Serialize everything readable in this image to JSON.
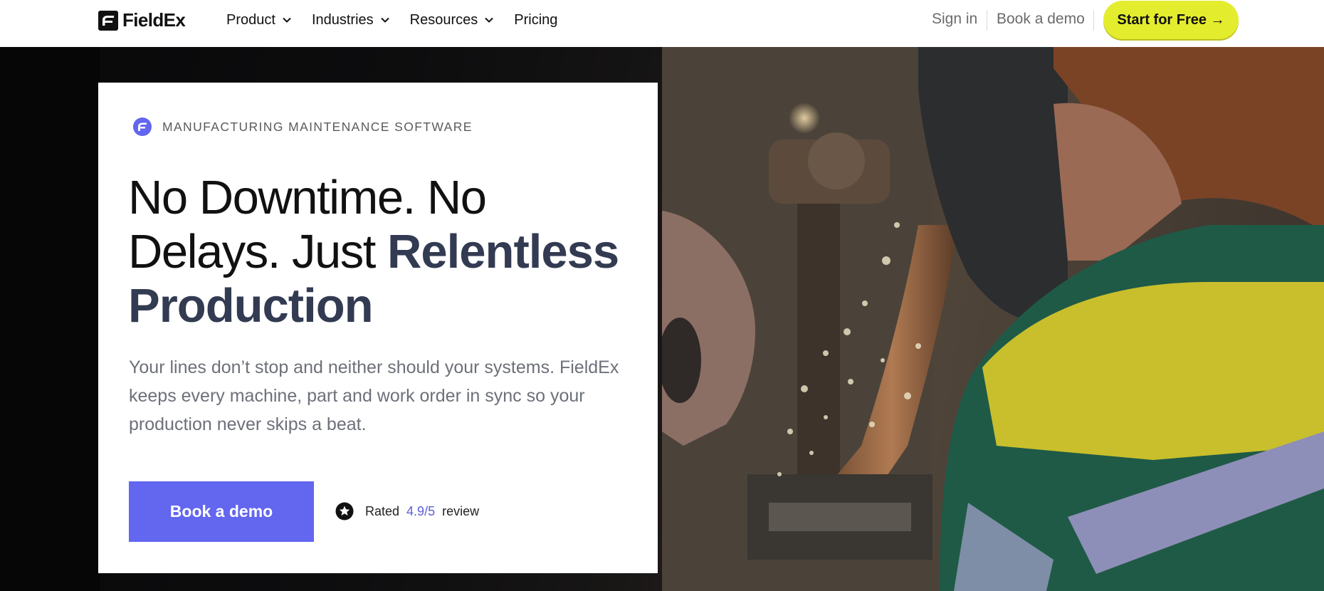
{
  "brand": {
    "name": "FieldEx",
    "logo_icon": "fieldex-logo-icon"
  },
  "nav": {
    "items": [
      {
        "label": "Product",
        "has_dropdown": true
      },
      {
        "label": "Industries",
        "has_dropdown": true
      },
      {
        "label": "Resources",
        "has_dropdown": true
      },
      {
        "label": "Pricing",
        "has_dropdown": false
      }
    ],
    "sign_in": "Sign in",
    "book_demo": "Book a demo",
    "cta": "Start for Free →"
  },
  "hero": {
    "eyebrow": "MANUFACTURING MAINTENANCE SOFTWARE",
    "headline_plain": "No Downtime. No Delays. Just ",
    "headline_accent": "Relentless Production",
    "subtext": "Your lines don’t stop and neither should your systems. FieldEx keeps every machine, part and work order in sync so your production never skips a beat.",
    "button": "Book a demo",
    "rating_prefix": "Rated",
    "rating_value": "4.9/5",
    "rating_suffix": "review"
  },
  "colors": {
    "cta_bg": "#e4ec2e",
    "button_bg": "#6366ef",
    "accent_text": "#323b52",
    "rating_value": "#5b5fd6"
  }
}
